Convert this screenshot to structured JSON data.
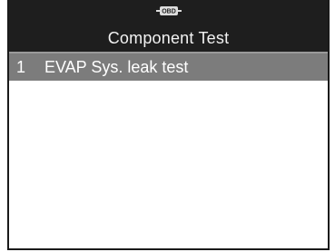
{
  "header": {
    "icon": "obd-icon",
    "icon_text": "OBD",
    "title": "Component Test"
  },
  "list": {
    "items": [
      {
        "number": "1",
        "label": "EVAP Sys. leak test",
        "selected": true
      }
    ]
  },
  "colors": {
    "header_bg": "#1e1e1e",
    "selected_bg": "#7c7c7c",
    "screen_bg": "#ffffff"
  }
}
